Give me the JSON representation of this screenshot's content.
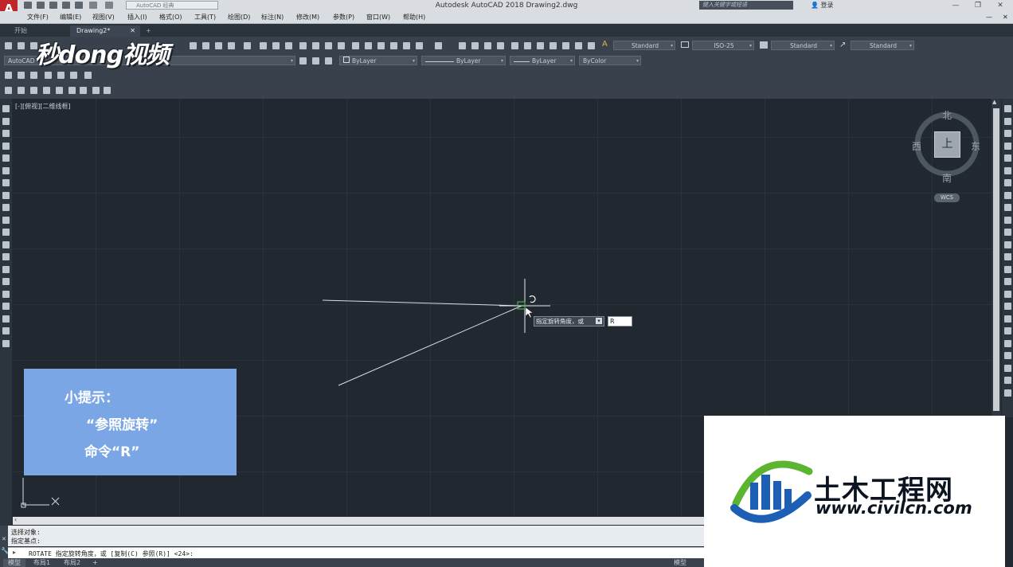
{
  "app": {
    "title": "Autodesk AutoCAD 2018    Drawing2.dwg",
    "logo_letter": "A",
    "workspace": "AutoCAD 经典",
    "search_placeholder": "键入关键字或短语",
    "login": "登录",
    "window_buttons": [
      "—",
      "❐",
      "✕"
    ]
  },
  "menu": [
    "文件(F)",
    "编辑(E)",
    "视图(V)",
    "插入(I)",
    "格式(O)",
    "工具(T)",
    "绘图(D)",
    "标注(N)",
    "修改(M)",
    "参数(P)",
    "窗口(W)",
    "帮助(H)"
  ],
  "tabs": [
    {
      "label": "开始",
      "active": false
    },
    {
      "label": "Drawing2*",
      "active": true
    }
  ],
  "tab_close": "✕",
  "tab_add": "+",
  "styles": {
    "text_style": "Standard",
    "dim_style": "ISO-25",
    "table_style": "Standard",
    "mleader_style": "Standard"
  },
  "properties": {
    "workspace_short": "AutoCAD",
    "layer": "ByLayer",
    "linetype": "ByLayer",
    "lineweight": "ByLayer",
    "color": "ByColor"
  },
  "video_logo": "秒dong视频",
  "viewport_label": "[-][俯视][二维线框]",
  "viewcube": {
    "north": "北",
    "south": "南",
    "east": "东",
    "west": "西",
    "top": "上",
    "wcs": "WCS"
  },
  "dynamic_input": {
    "prompt": "指定旋转角度，或",
    "arrow": "▾",
    "value": "R"
  },
  "hint": {
    "line1": "小提示：",
    "line2": "“参照旋转”",
    "line3": "命令“R”"
  },
  "command": {
    "history": [
      "选择对象:",
      "指定基点:"
    ],
    "current": "ROTATE 指定旋转角度，或 [复制(C) 参照(R)] <24>:"
  },
  "layout_tabs": [
    "模型",
    "布局1",
    "布局2"
  ],
  "status_right": "模型",
  "watermark": {
    "name": "土木工程网",
    "url": "www.civilcn.com"
  },
  "colors": {
    "canvas": "#212830",
    "hint_bg": "#7ba6e6",
    "brand_blue": "#1c5fb5",
    "brand_green": "#5bb531"
  }
}
